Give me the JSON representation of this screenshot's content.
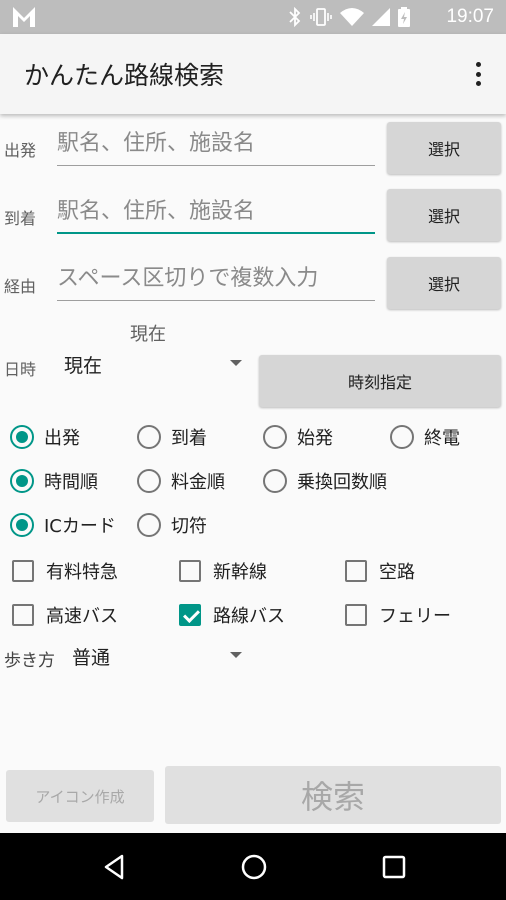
{
  "status_bar": {
    "time": "19:07",
    "icons": [
      "app-logo-icon",
      "bluetooth-icon",
      "vibrate-icon",
      "wifi-icon",
      "cell-signal-icon",
      "battery-icon"
    ]
  },
  "app_bar": {
    "title": "かんたん路線検索",
    "menu_icon": "more-vert-icon"
  },
  "form": {
    "departure": {
      "label": "出発",
      "placeholder": "駅名、住所、施設名",
      "select": "選択"
    },
    "arrival": {
      "label": "到着",
      "placeholder": "駅名、住所、施設名",
      "select": "選択"
    },
    "via": {
      "label": "経由",
      "placeholder": "スペース区切りで複数入力",
      "select": "選択"
    },
    "datetime": {
      "label": "日時",
      "caption": "現在",
      "value": "現在",
      "set_time_button": "時刻指定"
    }
  },
  "time_mode": {
    "options": [
      "出発",
      "到着",
      "始発",
      "終電"
    ],
    "selected": "出発"
  },
  "sort_order": {
    "options": [
      "時間順",
      "料金順",
      "乗換回数順"
    ],
    "selected": "時間順"
  },
  "fare_type": {
    "options": [
      "ICカード",
      "切符"
    ],
    "selected": "ICカード"
  },
  "transport": {
    "items": [
      {
        "label": "有料特急",
        "checked": false
      },
      {
        "label": "新幹線",
        "checked": false
      },
      {
        "label": "空路",
        "checked": false
      },
      {
        "label": "高速バス",
        "checked": false
      },
      {
        "label": "路線バス",
        "checked": true
      },
      {
        "label": "フェリー",
        "checked": false
      }
    ]
  },
  "walking": {
    "label": "歩き方",
    "value": "普通"
  },
  "footer": {
    "icon_button": "アイコン作成",
    "search_button": "検索"
  },
  "colors": {
    "accent": "#009688",
    "status_bar": "#bdbdbd",
    "nav_bar": "#000000"
  }
}
